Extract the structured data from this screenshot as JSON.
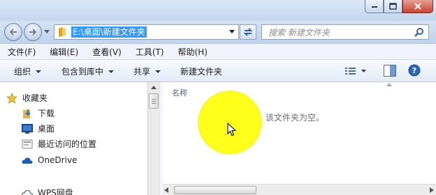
{
  "address": {
    "path": "E:\\桌面\\新建文件夹"
  },
  "search": {
    "placeholder": "搜索 新建文件夹"
  },
  "menu": [
    "文件(F)",
    "编辑(E)",
    "查看(V)",
    "工具(T)",
    "帮助(H)"
  ],
  "toolbar": {
    "organize": "组织",
    "include_in_library": "包含到库中",
    "share": "共享",
    "new_folder": "新建文件夹"
  },
  "sidebar": {
    "favorites": "收藏夹",
    "items": [
      "下载",
      "桌面",
      "最近访问的位置"
    ],
    "onedrive": "OneDrive",
    "wps": "WPS网盘"
  },
  "content": {
    "column_name": "名称",
    "empty_message": "该文件夹为空。"
  },
  "colors": {
    "accent": "#3399ff",
    "highlight": "#ffff00"
  }
}
